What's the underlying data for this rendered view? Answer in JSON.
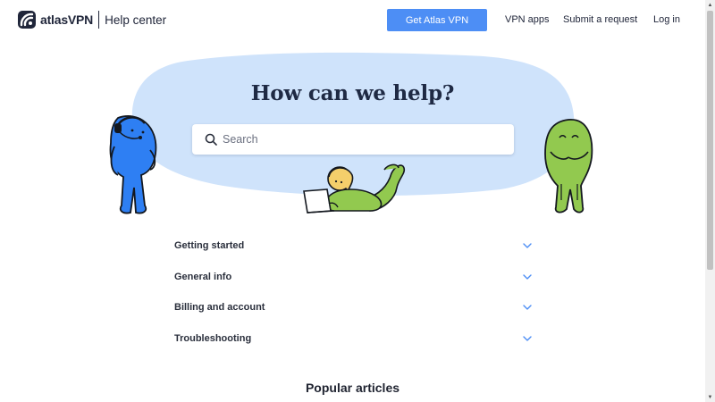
{
  "header": {
    "brand": "atlasVPN",
    "section": "Help center",
    "cta_label": "Get Atlas VPN",
    "nav": [
      {
        "label": "VPN apps"
      },
      {
        "label": "Submit a request"
      },
      {
        "label": "Log in"
      }
    ]
  },
  "hero": {
    "title": "How can we help?",
    "search_placeholder": "Search"
  },
  "accordion": {
    "items": [
      {
        "label": "Getting started"
      },
      {
        "label": "General info"
      },
      {
        "label": "Billing and account"
      },
      {
        "label": "Troubleshooting"
      }
    ]
  },
  "popular": {
    "title": "Popular articles"
  },
  "colors": {
    "accent": "#4d8ef5",
    "blob": "#cfe3fb",
    "mascot_blue": "#2e7ff3",
    "mascot_green": "#92c94f"
  },
  "icons": {
    "logo": "atlas-logo-icon",
    "search": "search-icon",
    "chevron": "chevron-down-icon",
    "scroll_up": "scroll-up-arrow-icon",
    "scroll_down": "scroll-down-arrow-icon"
  }
}
